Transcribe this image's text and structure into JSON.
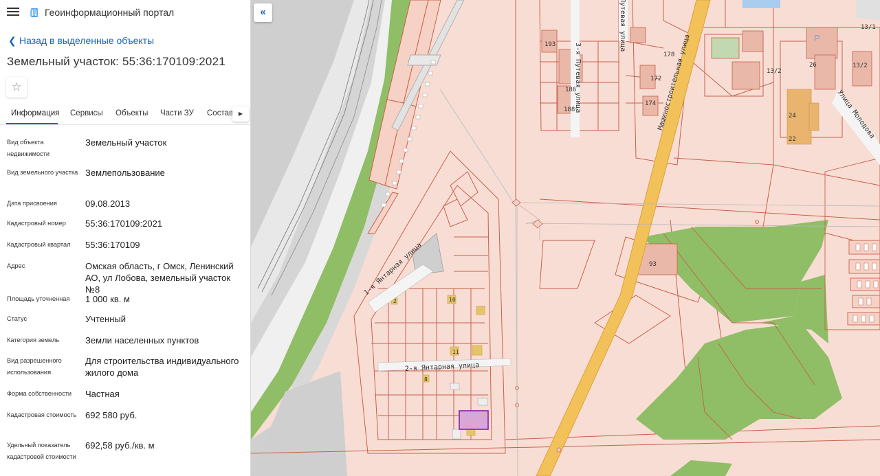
{
  "header": {
    "app_title": "Геоинформационный портал",
    "menu_icon": "hamburger-icon",
    "logo_icon": "portal-logo-icon"
  },
  "nav": {
    "back_label": "Назад в выделенные объекты"
  },
  "object": {
    "title": "Земельный участок: 55:36:170109:2021"
  },
  "tabs": [
    {
      "label": "Информация",
      "active": true
    },
    {
      "label": "Сервисы"
    },
    {
      "label": "Объекты"
    },
    {
      "label": "Части ЗУ"
    },
    {
      "label": "Состав"
    }
  ],
  "attributes": [
    {
      "label": "Вид объекта недвижимости",
      "value": "Земельный участок"
    },
    {
      "label": "Вид земельного участка",
      "value": "Землепользование"
    },
    {
      "label": "Дата присвоения",
      "value": "09.08.2013"
    },
    {
      "label": "Кадастровый номер",
      "value": "55:36:170109:2021"
    },
    {
      "label": "Кадастровый квартал",
      "value": "55:36:170109"
    },
    {
      "label": "Адрес",
      "value": "Омская область, г Омск, Ленинский АО, ул Лобова, земельный участок №8"
    },
    {
      "label": "Площадь уточненная",
      "value": "1 000 кв. м"
    },
    {
      "label": "Статус",
      "value": "Учтенный"
    },
    {
      "label": "Категория земель",
      "value": "Земли населенных пунктов"
    },
    {
      "label": "Вид разрешенного использования",
      "value": "Для строительства индивидуального жилого дома"
    },
    {
      "label": "Форма собственности",
      "value": "Частная"
    },
    {
      "label": "Кадастровая стоимость",
      "value": "692 580 руб."
    },
    {
      "label": "Удельный показатель кадастровой стоимости",
      "value": "692,58 руб./кв. м"
    }
  ],
  "map": {
    "streets": {
      "yantarnaya1": "1-я Янтарная улица",
      "yantarnaya2": "2-я Янтарная улица",
      "mashinostroitelnaya": "Машиностроительная улица",
      "putevaya3": "3-я Путевая улица",
      "putevaya": "Путевая улица",
      "molodova": "Улица Молодова"
    },
    "house_numbers": [
      "193",
      "186",
      "188",
      "178",
      "172",
      "174",
      "13/2",
      "26",
      "24",
      "22",
      "93",
      "13/1",
      "13/2",
      "2",
      "10",
      "11",
      "8"
    ],
    "parking_label": "P",
    "colors": {
      "parcel_fill": "#f7dcd3",
      "parcel_border": "#c9604a",
      "road": "#f3c15a",
      "park": "#8fbe66",
      "railway_zone": "#d5d5d5",
      "highlight": "#d9a7d6"
    }
  }
}
